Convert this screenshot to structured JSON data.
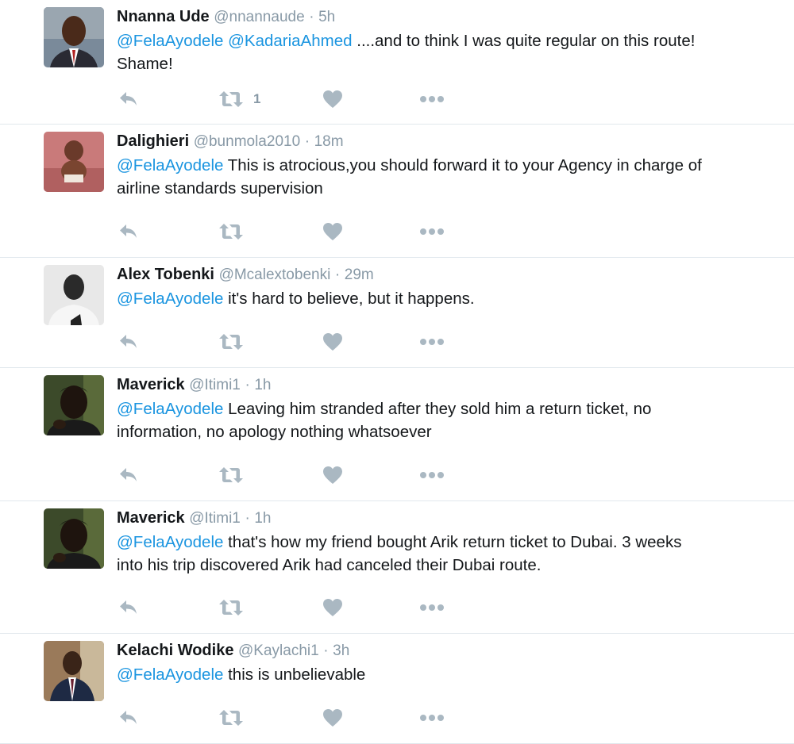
{
  "tweets": [
    {
      "fullname": "Nnanna Ude",
      "handle": "@nnannaude",
      "time": "5h",
      "lines": [
        [
          {
            "t": "@FelaAyodele",
            "m": true
          },
          {
            "t": " ",
            "m": false
          },
          {
            "t": "@KadariaAhmed",
            "m": true
          },
          {
            "t": " ....and to think I was quite regular on this route!",
            "m": false
          }
        ],
        [
          {
            "t": "Shame!",
            "m": false
          }
        ]
      ],
      "retweet_count": "1",
      "avatar": "man-suit-red-tie"
    },
    {
      "fullname": "Dalighieri",
      "handle": "@bunmola2010",
      "time": "18m",
      "lines": [
        [
          {
            "t": "@FelaAyodele",
            "m": true
          },
          {
            "t": " This is atrocious,you should forward it to your Agency in charge of",
            "m": false
          }
        ],
        [
          {
            "t": "airline standards supervision",
            "m": false
          }
        ]
      ],
      "retweet_count": "",
      "avatar": "baby-photo"
    },
    {
      "fullname": "Alex Tobenki",
      "handle": "@Mcalextobenki",
      "time": "29m",
      "lines": [
        [
          {
            "t": "@FelaAyodele",
            "m": true
          },
          {
            "t": " it's hard to believe, but it happens.",
            "m": false
          }
        ]
      ],
      "retweet_count": "",
      "avatar": "grayscale-portrait"
    },
    {
      "fullname": "Maverick",
      "handle": "@Itimi1",
      "time": "1h",
      "lines": [
        [
          {
            "t": "@FelaAyodele",
            "m": true
          },
          {
            "t": " Leaving him stranded after they sold him a return ticket, no",
            "m": false
          }
        ],
        [
          {
            "t": "information, no apology nothing whatsoever",
            "m": false
          }
        ]
      ],
      "retweet_count": "",
      "avatar": "dark-portrait"
    },
    {
      "fullname": "Maverick",
      "handle": "@Itimi1",
      "time": "1h",
      "lines": [
        [
          {
            "t": "@FelaAyodele",
            "m": true
          },
          {
            "t": " that's how my friend bought Arik return ticket to Dubai. 3 weeks",
            "m": false
          }
        ],
        [
          {
            "t": "into his trip discovered Arik had canceled their Dubai route.",
            "m": false
          }
        ]
      ],
      "retweet_count": "",
      "avatar": "dark-portrait"
    },
    {
      "fullname": "Kelachi Wodike",
      "handle": "@Kaylachi1",
      "time": "3h",
      "lines": [
        [
          {
            "t": "@FelaAyodele",
            "m": true
          },
          {
            "t": " this is unbelievable",
            "m": false
          }
        ]
      ],
      "retweet_count": "",
      "avatar": "man-selfie-suit"
    }
  ],
  "separator": "·",
  "icons": {
    "reply": "reply-icon",
    "retweet": "retweet-icon",
    "like": "heart-icon",
    "more": "more-icon"
  },
  "colors": {
    "mention": "#1b95e0",
    "muted": "#8899a6",
    "icon": "#aab8c2",
    "border": "#e1e8ed"
  }
}
